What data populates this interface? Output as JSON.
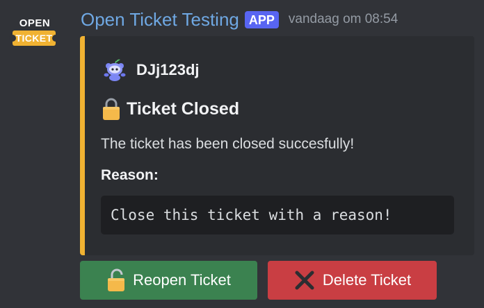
{
  "bot": {
    "avatar_top_text": "OPEN",
    "avatar_bottom_text": "TICKET",
    "name": "Open Ticket Testing",
    "badge": "APP",
    "timestamp": "vandaag om 08:54"
  },
  "embed": {
    "accent_color": "#f0b232",
    "author": {
      "icon": "wumpus-icon",
      "name": "DJj123dj"
    },
    "title_icon": "lock-icon",
    "title": "Ticket Closed",
    "description": "The ticket has been closed succesfully!",
    "field": {
      "name": "Reason:",
      "value": "Close this ticket with a reason!"
    }
  },
  "buttons": [
    {
      "icon": "unlock-icon",
      "label": "Reopen Ticket",
      "color": "#3b8250"
    },
    {
      "icon": "cross-icon",
      "label": "Delete Ticket",
      "color": "#c93e43"
    }
  ]
}
